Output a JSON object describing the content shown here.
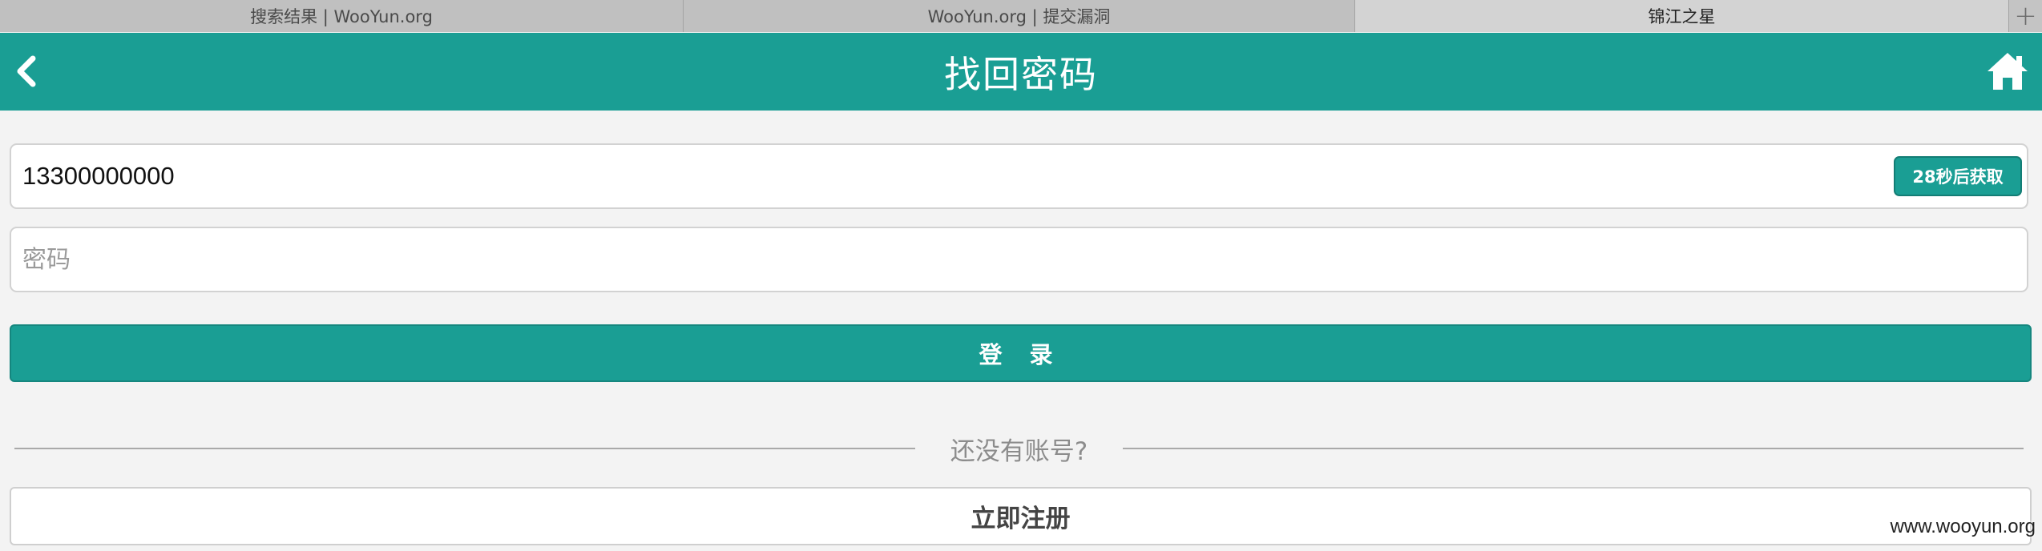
{
  "browser": {
    "tabs": [
      {
        "label": "搜索结果 | WooYun.org",
        "active": false
      },
      {
        "label": "WooYun.org | 提交漏洞",
        "active": false
      },
      {
        "label": "锦江之星",
        "active": true
      }
    ],
    "new_tab_symbol": "+"
  },
  "header": {
    "title": "找回密码",
    "back_icon": "chevron-left-icon",
    "home_icon": "home-icon",
    "background_color": "#1a9e94"
  },
  "form": {
    "phone": {
      "value": "13300000000",
      "placeholder": ""
    },
    "code_button_label": "28秒后获取",
    "password": {
      "value": "",
      "placeholder": "密码"
    },
    "login_label": "登 录"
  },
  "register": {
    "prompt": "还没有账号?",
    "button_label": "立即注册"
  },
  "watermark": "www.wooyun.org"
}
